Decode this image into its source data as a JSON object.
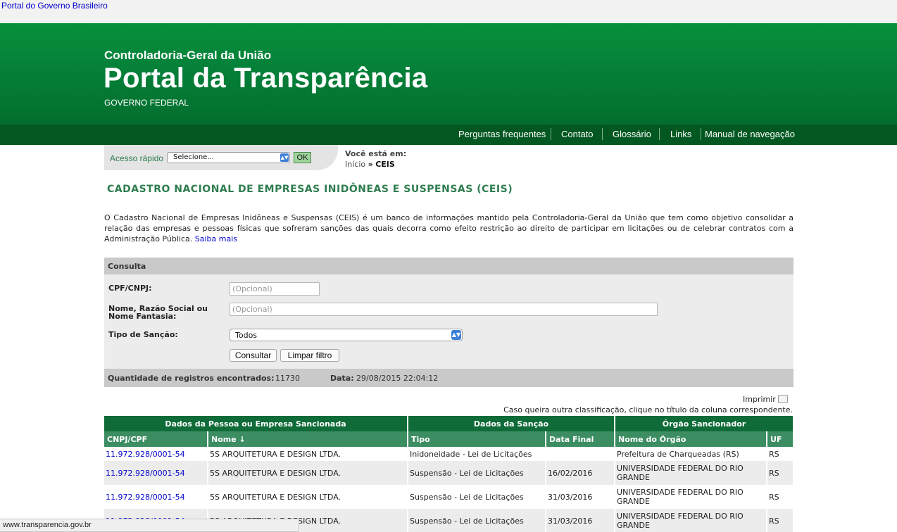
{
  "govbar": {
    "link": "Portal do Governo Brasileiro"
  },
  "header": {
    "org": "Controladoria-Geral da União",
    "title": "Portal da Transparência",
    "subtitle": "GOVERNO FEDERAL"
  },
  "nav": {
    "items": [
      {
        "label": "Perguntas frequentes"
      },
      {
        "label": "Contato"
      },
      {
        "label": "Glossário"
      },
      {
        "label": "Links"
      },
      {
        "label": "Manual de navegação"
      }
    ]
  },
  "quick_access": {
    "label": "Acesso rápido",
    "select_value": "Selecione...",
    "ok_label": "OK"
  },
  "breadcrumb": {
    "heading": "Você está em:",
    "home": "Início",
    "separator": "»",
    "current": "CEIS"
  },
  "page_title": "CADASTRO NACIONAL DE EMPRESAS INIDÔNEAS E SUSPENSAS (CEIS)",
  "description": {
    "text": "O Cadastro Nacional de Empresas Inidôneas e Suspensas (CEIS) é um banco de informações mantido pela Controladoria-Geral da União que tem como objetivo consolidar a relação das empresas e pessoas físicas que sofreram sanções das quais decorra como efeito restrição ao direito de participar em licitações ou de celebrar contratos com a Administração Pública.",
    "link": "Saiba mais"
  },
  "consulta": {
    "title": "Consulta",
    "cpf_label": "CPF/CNPJ:",
    "cpf_placeholder": "(Opcional)",
    "nome_label": "Nome, Razão Social ou Nome Fantasia:",
    "nome_placeholder": "(Opcional)",
    "tipo_label": "Tipo de Sanção:",
    "tipo_value": "Todos",
    "submit_label": "Consultar",
    "clear_label": "Limpar filtro",
    "count_label": "Quantidade de registros encontrados:",
    "count_value": "11730",
    "date_label": "Data:",
    "date_value": "29/08/2015 22:04:12"
  },
  "print_label": "Imprimir",
  "sort_hint": "Caso queira outra classificação, clique no título da coluna correspondente.",
  "table": {
    "groups": [
      "Dados da Pessoa ou Empresa Sancionada",
      "Dados da Sanção",
      "Órgão Sancionador"
    ],
    "columns": [
      "CNPJ/CPF",
      "Nome ↓",
      "Tipo",
      "Data Final",
      "Nome do Órgão",
      "UF"
    ],
    "rows": [
      {
        "cnpj": "11.972.928/0001-54",
        "nome": "5S ARQUITETURA E DESIGN LTDA.",
        "tipo": "Inidoneidade - Lei de Licitações",
        "data": "",
        "orgao": "Prefeitura de Charqueadas (RS)",
        "uf": "RS"
      },
      {
        "cnpj": "11.972.928/0001-54",
        "nome": "5S ARQUITETURA E DESIGN LTDA.",
        "tipo": "Suspensão - Lei de Licitações",
        "data": "16/02/2016",
        "orgao": "UNIVERSIDADE FEDERAL DO RIO GRANDE",
        "uf": "RS"
      },
      {
        "cnpj": "11.972.928/0001-54",
        "nome": "5S ARQUITETURA E DESIGN LTDA.",
        "tipo": "Suspensão - Lei de Licitações",
        "data": "31/03/2016",
        "orgao": "UNIVERSIDADE FEDERAL DO RIO GRANDE",
        "uf": "RS"
      },
      {
        "cnpj": "11.972.928/0001-54",
        "nome": "5S ARQUITETURA E DESIGN LTDA.",
        "tipo": "Suspensão - Lei de Licitações",
        "data": "31/03/2016",
        "orgao": "UNIVERSIDADE FEDERAL DO RIO GRANDE",
        "uf": "RS"
      }
    ]
  },
  "status_bar": "www.transparencia.gov.br"
}
